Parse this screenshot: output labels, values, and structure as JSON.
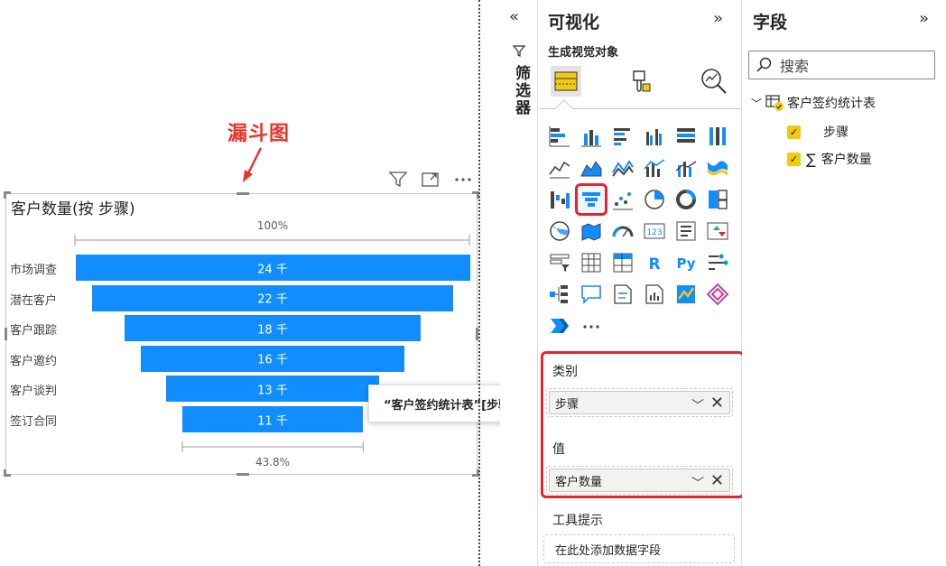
{
  "annotation": {
    "text": "漏斗图"
  },
  "visual": {
    "title": "客户数量(按 步骤)",
    "top_pct": "100%",
    "bottom_pct": "43.8%",
    "header_icons": [
      "filter-icon",
      "focus-mode-icon",
      "more-options-icon"
    ]
  },
  "chart_data": {
    "type": "funnel",
    "title": "客户数量(按 步骤)",
    "categories": [
      "市场调查",
      "潜在客户",
      "客户跟踪",
      "客户邀约",
      "客户谈判",
      "签订合同"
    ],
    "values": [
      24,
      22,
      18,
      16,
      13,
      11
    ],
    "value_labels": [
      "24 千",
      "22 千",
      "18 千",
      "16 千",
      "13 千",
      "11 千"
    ],
    "unit": "千",
    "first_pct": "100%",
    "last_pct": "43.8%",
    "color": "#118dff"
  },
  "tooltip": {
    "text": "“客户签约统计表”[步骤]"
  },
  "filters": {
    "label": "筛选器"
  },
  "viz_pane": {
    "title": "可视化",
    "build_label": "生成视觉对象",
    "wells": {
      "category_label": "类别",
      "category_value": "步骤",
      "values_label": "值",
      "values_value": "客户数量",
      "tooltip_label": "工具提示",
      "tooltip_placeholder": "在此处添加数据字段"
    },
    "more": "···"
  },
  "fields_pane": {
    "title": "字段",
    "search_placeholder": "搜索",
    "table_name": "客户签约统计表",
    "fields": [
      {
        "name": "步骤",
        "checked": true
      },
      {
        "name": "客户数量",
        "checked": true,
        "sigma": "∑"
      }
    ]
  },
  "colors": {
    "accent": "#118dff",
    "highlight": "#e8242a",
    "check": "#f2c811"
  }
}
